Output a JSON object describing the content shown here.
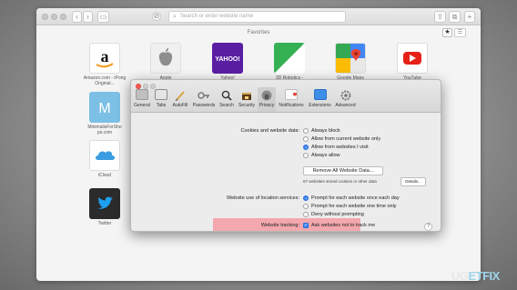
{
  "browser": {
    "url_placeholder": "Search or enter website name",
    "favorites_title": "Favorites",
    "favorites_star": "★",
    "tiles": [
      {
        "label": "Amazon.com - iPong Original...",
        "icon": "amazon-logo",
        "color": "#ffffff"
      },
      {
        "label": "Apple",
        "icon": "apple-logo",
        "color": "#f0f0f0"
      },
      {
        "label": "Yahoo!",
        "icon": "yahoo-logo",
        "text": "YAHOO!",
        "color": "#5a1ea3"
      },
      {
        "label": "3D Robotics - Drones...",
        "icon": "3dr-logo",
        "color": "#35b154"
      },
      {
        "label": "Google Maps",
        "icon": "google-maps-logo",
        "color": "#4285f4"
      },
      {
        "label": "YouTube",
        "icon": "youtube-logo",
        "color": "#e62117"
      },
      {
        "label": "MinimalisForSho ps.com",
        "icon": "letter-m-tile",
        "text": "M",
        "color": "#7cc0e6"
      },
      {
        "label": "iCloud",
        "icon": "icloud-logo",
        "color": "#ffffff"
      },
      {
        "label": "Twitter",
        "icon": "twitter-logo",
        "color": "#2b2b2b"
      }
    ]
  },
  "prefs": {
    "tabs": [
      {
        "label": "General",
        "icon": "general-icon"
      },
      {
        "label": "Tabs",
        "icon": "tabs-icon"
      },
      {
        "label": "AutoFill",
        "icon": "autofill-icon"
      },
      {
        "label": "Passwords",
        "icon": "passwords-icon"
      },
      {
        "label": "Search",
        "icon": "search-icon"
      },
      {
        "label": "Security",
        "icon": "security-icon"
      },
      {
        "label": "Privacy",
        "icon": "privacy-icon"
      },
      {
        "label": "Notifications",
        "icon": "notifications-icon"
      },
      {
        "label": "Extensions",
        "icon": "extensions-icon"
      },
      {
        "label": "Advanced",
        "icon": "advanced-icon"
      }
    ],
    "selected_tab": "Privacy",
    "cookies_label": "Cookies and website data:",
    "cookie_options": [
      {
        "label": "Always block",
        "selected": false
      },
      {
        "label": "Allow from current website only",
        "selected": false
      },
      {
        "label": "Allow from websites I visit",
        "selected": true
      },
      {
        "label": "Always allow",
        "selected": false
      }
    ],
    "remove_button": "Remove All Website Data...",
    "stored_text": "67 websites stored cookies or other data",
    "details_button": "Details...",
    "location_label": "Website use of location services:",
    "location_options": [
      {
        "label": "Prompt for each website once each day",
        "selected": true
      },
      {
        "label": "Prompt for each website one time only",
        "selected": false
      },
      {
        "label": "Deny without prompting",
        "selected": false
      }
    ],
    "tracking_label": "Website tracking:",
    "tracking_option": "Ask websites not to track me",
    "tracking_checked": true,
    "help": "?"
  },
  "watermark": {
    "main": "UG",
    "accent": "ETFIX"
  }
}
